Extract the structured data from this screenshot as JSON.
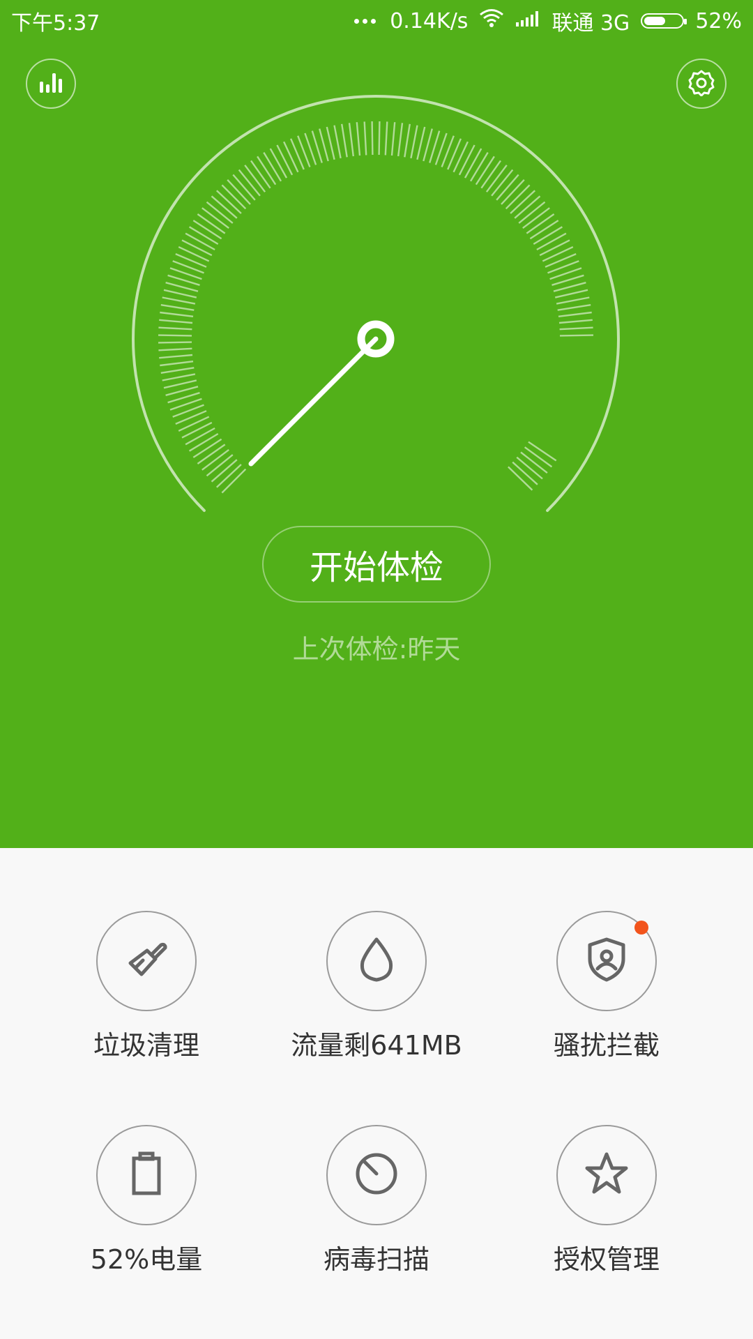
{
  "status_bar": {
    "time": "下午5:37",
    "speed": "0.14K/s",
    "carrier": "联通 3G",
    "battery_percent": "52%",
    "battery_level": 0.52
  },
  "header": {
    "stats_icon": "bar-chart-icon",
    "settings_icon": "gear-icon"
  },
  "gauge": {
    "needle_icon": "speed-needle"
  },
  "main": {
    "start_label": "开始体检",
    "last_check": "上次体检:昨天"
  },
  "tools": [
    {
      "label": "垃圾清理",
      "icon": "broom-icon"
    },
    {
      "label": "流量剩641MB",
      "icon": "water-drop-icon"
    },
    {
      "label": "骚扰拦截",
      "icon": "shield-user-icon",
      "badge": true
    },
    {
      "label": "52%电量",
      "icon": "battery-icon"
    },
    {
      "label": "病毒扫描",
      "icon": "scan-icon"
    },
    {
      "label": "授权管理",
      "icon": "star-icon"
    }
  ],
  "colors": {
    "primary_green": "#52b019",
    "badge": "#f2541c",
    "icon_gray": "#666666"
  }
}
